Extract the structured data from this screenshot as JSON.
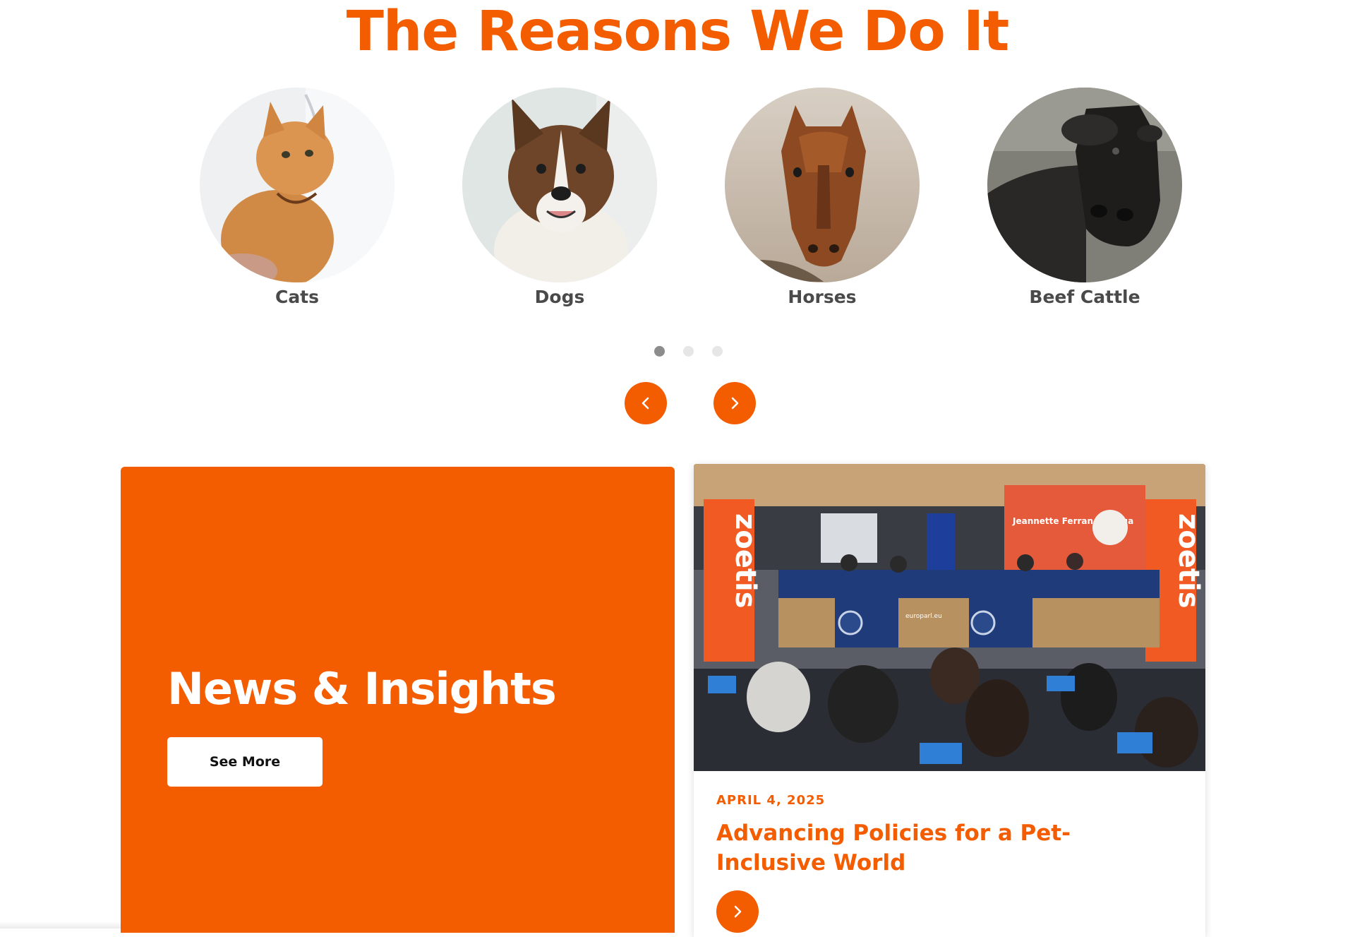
{
  "section": {
    "title": "The Reasons We Do It"
  },
  "animals": [
    {
      "label": "Cats",
      "icon": "cat-photo"
    },
    {
      "label": "Dogs",
      "icon": "dog-photo"
    },
    {
      "label": "Horses",
      "icon": "horse-photo"
    },
    {
      "label": "Beef Cattle",
      "icon": "cattle-photo"
    }
  ],
  "carousel": {
    "pages": 3,
    "active_page": 1
  },
  "news": {
    "title": "News & Insights",
    "see_more_label": "See More"
  },
  "article": {
    "date": "APRIL 4, 2025",
    "headline": "Advancing Policies for a Pet-Inclusive World",
    "photo": {
      "banner_text": "zoetis",
      "screen_name": "Jeannette Ferran Astorga",
      "desk_text": "europarl.eu"
    }
  },
  "colors": {
    "accent": "#f45c00",
    "label": "#4a4a4a",
    "dot_active": "#8c8c8c",
    "dot_inactive": "#e6e6e6"
  }
}
